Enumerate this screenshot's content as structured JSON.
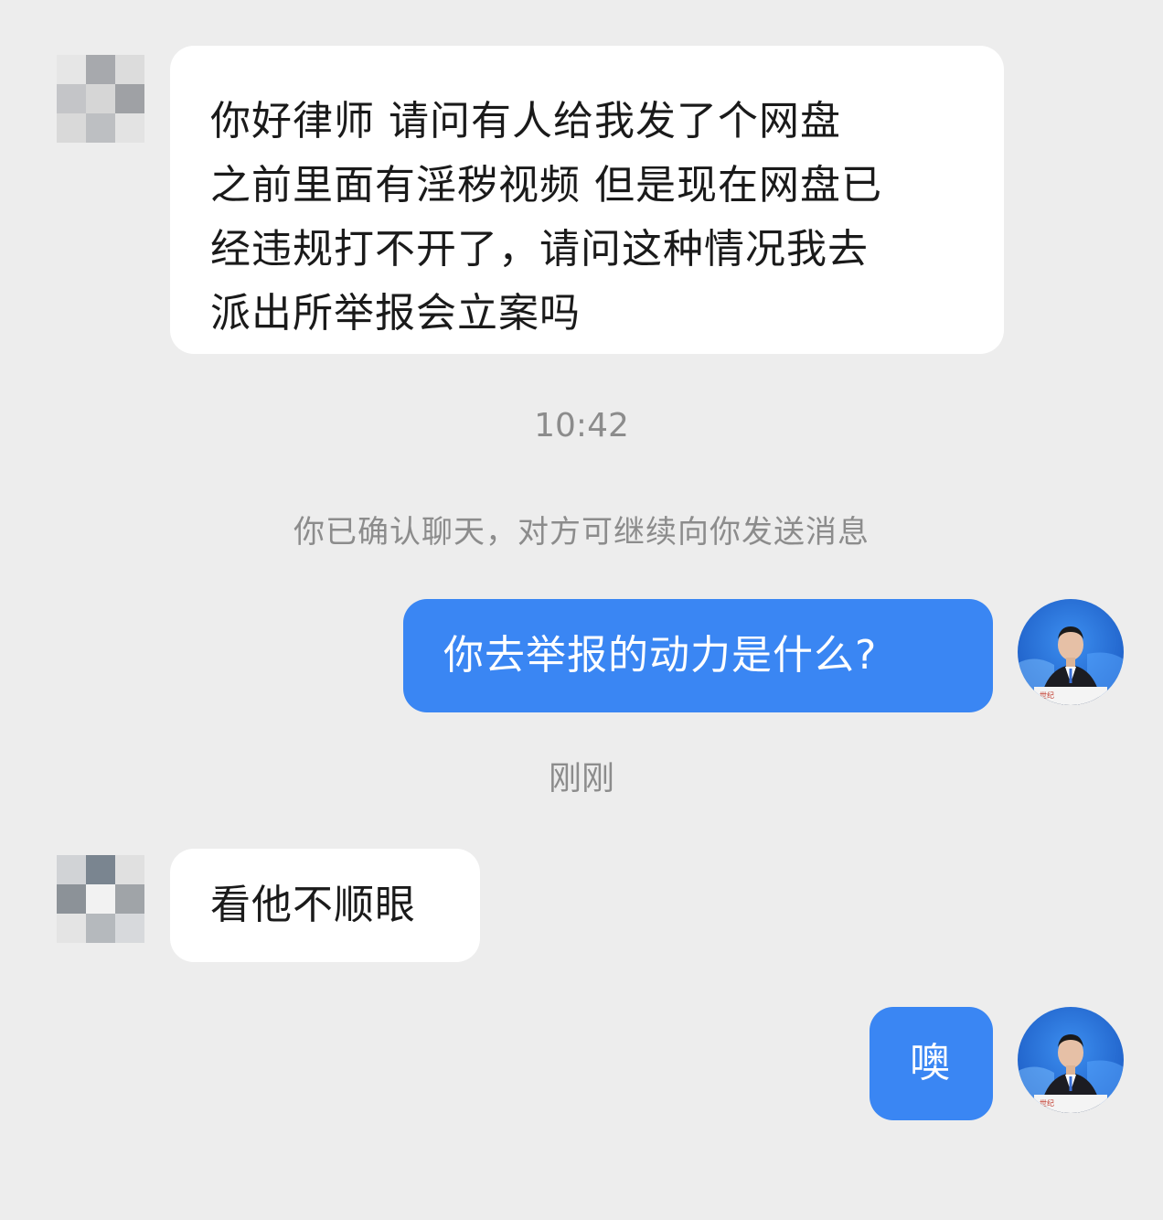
{
  "messages": [
    {
      "id": "m1",
      "sender": "client",
      "text": "你好律师 请问有人给我发了个网盘\n之前里面有淫秽视频 但是现在网盘已\n经违规打不开了，请问这种情况我去\n派出所举报会立案吗"
    },
    {
      "id": "m2",
      "sender": "lawyer",
      "text": "你去举报的动力是什么?"
    },
    {
      "id": "m3",
      "sender": "client",
      "text": "看他不顺眼"
    },
    {
      "id": "m4",
      "sender": "lawyer",
      "text": "噢"
    }
  ],
  "timestamps": {
    "first": "10:42",
    "second": "刚刚"
  },
  "system_notice": "你已确认聊天，对方可继续向你发送消息",
  "avatars": {
    "client": "blurred-pixel-avatar",
    "lawyer": "lawyer-photo-avatar"
  },
  "colors": {
    "background": "#ededed",
    "incoming_bubble": "#ffffff",
    "outgoing_bubble": "#3a86f3",
    "meta_text": "#8c8c8c"
  }
}
